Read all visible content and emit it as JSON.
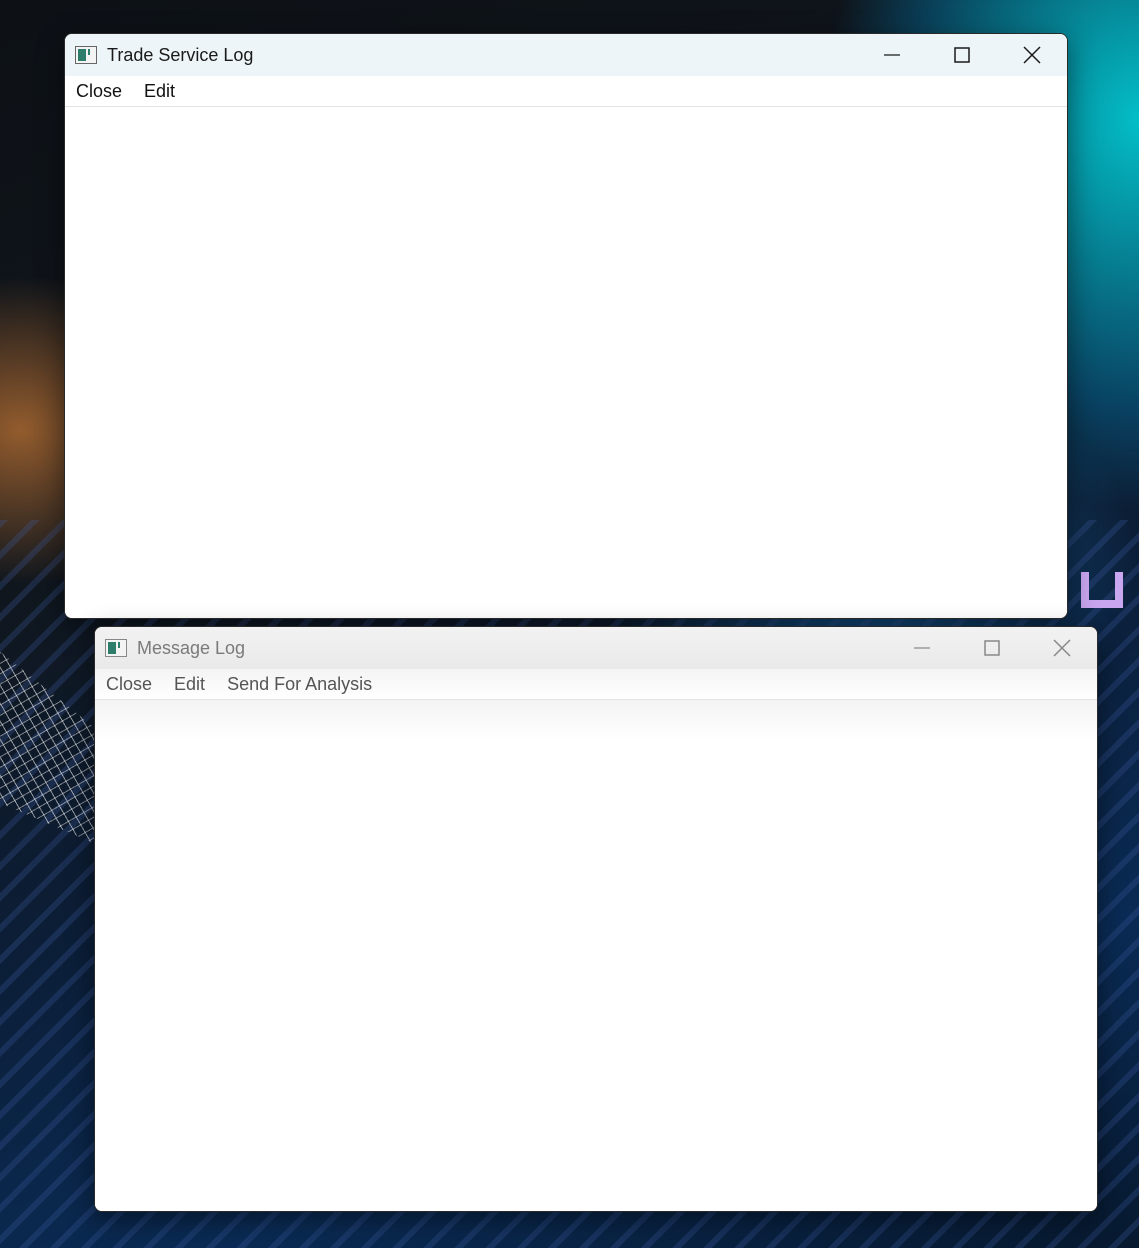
{
  "windows": [
    {
      "title": "Trade Service Log",
      "active": true,
      "menu": [
        "Close",
        "Edit"
      ],
      "icon": "app-window-icon"
    },
    {
      "title": "Message Log",
      "active": false,
      "menu": [
        "Close",
        "Edit",
        "Send For Analysis"
      ],
      "icon": "app-window-icon"
    }
  ],
  "caption_buttons": {
    "minimize": "minimize-icon",
    "maximize": "maximize-icon",
    "close": "close-icon"
  },
  "colors": {
    "active_titlebar": "#eef5f9",
    "inactive_titlebar": "#ececec",
    "inactive_text": "#7a7a7a",
    "icon_accent": "#2e7d6b"
  }
}
